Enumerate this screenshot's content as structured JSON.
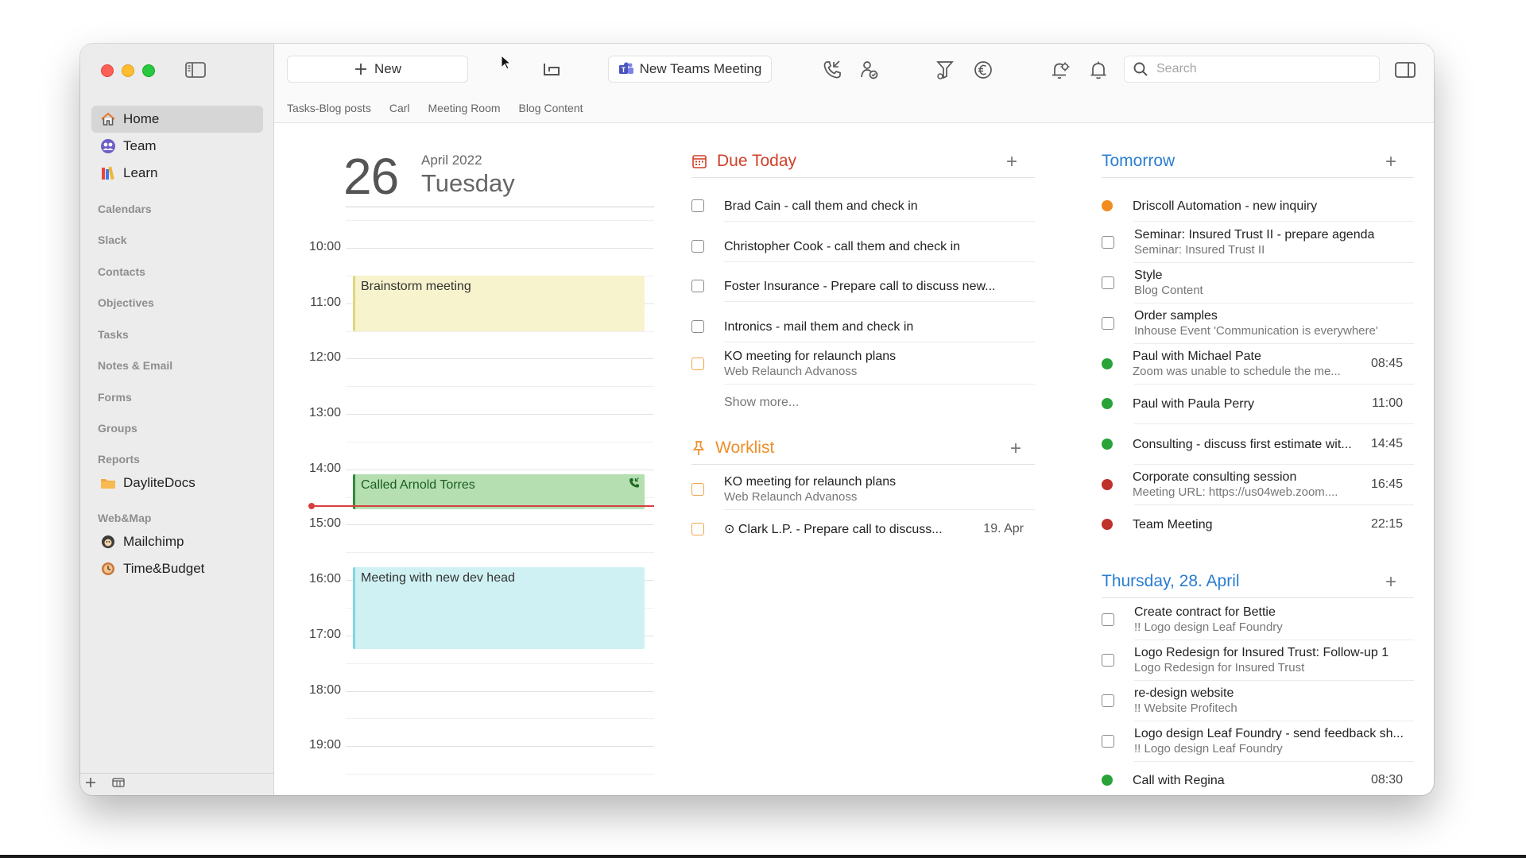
{
  "toolbar": {
    "new_label": "New",
    "teams_label": "New Teams Meeting",
    "search_placeholder": "Search"
  },
  "tabs": [
    "Tasks-Blog posts",
    "Carl",
    "Meeting Room",
    "Blog Content"
  ],
  "sidebar": {
    "items": [
      {
        "label": "Home",
        "icon": "home-icon"
      },
      {
        "label": "Team",
        "icon": "team-icon"
      },
      {
        "label": "Learn",
        "icon": "books-icon"
      }
    ],
    "sections": [
      "Calendars",
      "Slack",
      "Contacts",
      "Objectives",
      "Tasks",
      "Notes & Email",
      "Forms",
      "Groups",
      "Reports",
      "Web&Map"
    ],
    "reports_items": [
      {
        "label": "DayliteDocs",
        "icon": "folder-icon"
      }
    ],
    "webmap_items": [
      {
        "label": "Mailchimp",
        "icon": "mailchimp-icon"
      },
      {
        "label": "Time&Budget",
        "icon": "time-budget-icon"
      }
    ]
  },
  "calendar": {
    "day_number": "26",
    "month_year": "April 2022",
    "weekday": "Tuesday",
    "hours": [
      "10:00",
      "11:00",
      "12:00",
      "13:00",
      "14:00",
      "15:00",
      "16:00",
      "17:00",
      "18:00",
      "19:00"
    ],
    "events": [
      {
        "title": "Brainstorm meeting",
        "color": "#f7f3cd"
      },
      {
        "title": "Called Arnold Torres",
        "color": "#b5dfb1"
      },
      {
        "title": "Meeting with new dev head",
        "color": "#d0f1f3"
      }
    ]
  },
  "due_today": {
    "title": "Due Today",
    "color": "#d0402a",
    "items": [
      {
        "title": "Brad Cain - call them and check in",
        "sub": ""
      },
      {
        "title": "Christopher Cook - call them and check in",
        "sub": ""
      },
      {
        "title": "Foster Insurance - Prepare call to discuss new...",
        "sub": ""
      },
      {
        "title": "Intronics - mail them and check in",
        "sub": ""
      },
      {
        "title": "KO meeting for relaunch plans",
        "sub": "Web Relaunch Advanoss"
      }
    ],
    "show_more": "Show more..."
  },
  "worklist": {
    "title": "Worklist",
    "color": "#ee8f2a",
    "items": [
      {
        "title": "KO meeting for relaunch plans",
        "sub": "Web Relaunch Advanoss",
        "date": ""
      },
      {
        "title": "⊙ Clark L.P. - Prepare call to discuss...",
        "sub": "",
        "date": "19. Apr"
      }
    ]
  },
  "tomorrow": {
    "title": "Tomorrow",
    "color": "#2a7dd1",
    "items": [
      {
        "kind": "dot",
        "dot_color": "#f28c1e",
        "title": "Driscoll Automation - new inquiry",
        "sub": "",
        "time": ""
      },
      {
        "kind": "check",
        "title": "Seminar: Insured Trust II - prepare agenda",
        "sub": "Seminar: Insured Trust II",
        "time": ""
      },
      {
        "kind": "check",
        "title": "Style",
        "sub": "Blog Content",
        "time": ""
      },
      {
        "kind": "check",
        "title": "Order samples",
        "sub": "Inhouse Event 'Communication is everywhere'",
        "time": ""
      },
      {
        "kind": "dot",
        "dot_color": "#2aa33a",
        "title": "Paul with Michael Pate",
        "sub": "Zoom was unable to schedule the me...",
        "time": "08:45"
      },
      {
        "kind": "dot",
        "dot_color": "#2aa33a",
        "title": "Paul with Paula Perry",
        "sub": "",
        "time": "11:00"
      },
      {
        "kind": "dot",
        "dot_color": "#2aa33a",
        "title": "Consulting - discuss first estimate wit...",
        "sub": "",
        "time": "14:45"
      },
      {
        "kind": "dot",
        "dot_color": "#c0312b",
        "title": "Corporate consulting session",
        "sub": "Meeting URL: https://us04web.zoom....",
        "time": "16:45"
      },
      {
        "kind": "dot",
        "dot_color": "#c0312b",
        "title": "Team Meeting",
        "sub": "",
        "time": "22:15"
      }
    ]
  },
  "thursday": {
    "title": "Thursday, 28. April",
    "color": "#2a7dd1",
    "items": [
      {
        "kind": "check",
        "title": "Create contract for Bettie",
        "sub": "!! Logo design Leaf Foundry",
        "time": ""
      },
      {
        "kind": "check",
        "title": "Logo Redesign for Insured Trust: Follow-up 1",
        "sub": "Logo Redesign for Insured Trust",
        "time": ""
      },
      {
        "kind": "check",
        "title": "re-design website",
        "sub": "!! Website Profitech",
        "time": ""
      },
      {
        "kind": "check",
        "title": "Logo design Leaf Foundry - send feedback sh...",
        "sub": "!! Logo design Leaf Foundry",
        "time": ""
      },
      {
        "kind": "dot",
        "dot_color": "#2aa33a",
        "title": "Call with Regina",
        "sub": "",
        "time": "08:30"
      }
    ]
  }
}
